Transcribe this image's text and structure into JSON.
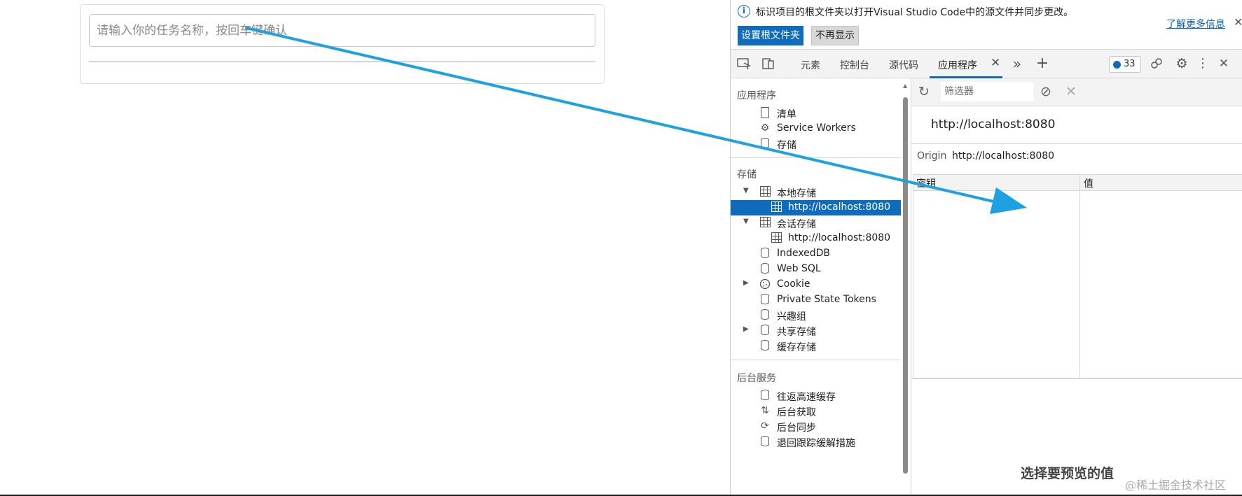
{
  "app": {
    "input_placeholder": "请输入你的任务名称，按回车键确认"
  },
  "infobar": {
    "message": "标识项目的根文件夹以打开Visual Studio Code中的源文件并同步更改。",
    "learn_more": "了解更多信息",
    "primary_button": "设置根文件夹",
    "secondary_button": "不再显示"
  },
  "tabs": {
    "elements": "元素",
    "console": "控制台",
    "sources": "源代码",
    "application": "应用程序",
    "issues_count": "33"
  },
  "sidebar": {
    "app_section": "应用程序",
    "app_items": [
      "清单",
      "Service Workers",
      "存储"
    ],
    "storage_section": "存储",
    "local_storage": "本地存储",
    "local_storage_origin": "http://localhost:8080",
    "session_storage": "会话存储",
    "session_storage_origin": "http://localhost:8080",
    "storage_items": [
      "IndexedDB",
      "Web SQL",
      "Cookie",
      "Private State Tokens",
      "兴趣组",
      "共享存储",
      "缓存存储"
    ],
    "background_section": "后台服务",
    "background_items": [
      "往返高速缓存",
      "后台获取",
      "后台同步",
      "退回跟踪缓解措施"
    ]
  },
  "main": {
    "filter_placeholder": "筛选器",
    "origin_title": "http://localhost:8080",
    "origin_label": "Origin",
    "origin_value": "http://localhost:8080",
    "col_key": "密钥",
    "col_value": "值",
    "preview_message": "选择要预览的值"
  },
  "watermark": "@稀土掘金技术社区",
  "colors": {
    "accent": "#0f6cbd",
    "annotation_arrow": "#1ea1e0"
  }
}
